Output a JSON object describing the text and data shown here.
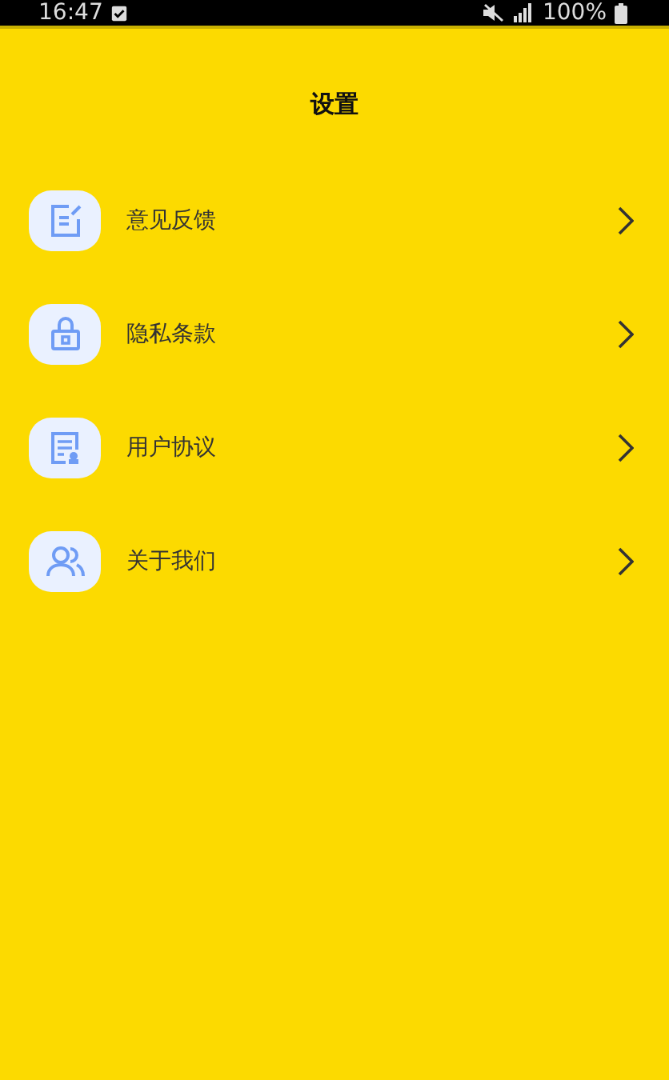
{
  "status_bar": {
    "time": "16:47",
    "battery": "100%"
  },
  "title": "设置",
  "items": [
    {
      "kind": "feedback",
      "label": "意见反馈"
    },
    {
      "kind": "privacy",
      "label": "隐私条款"
    },
    {
      "kind": "agreement",
      "label": "用户协议"
    },
    {
      "kind": "about",
      "label": "关于我们"
    }
  ]
}
